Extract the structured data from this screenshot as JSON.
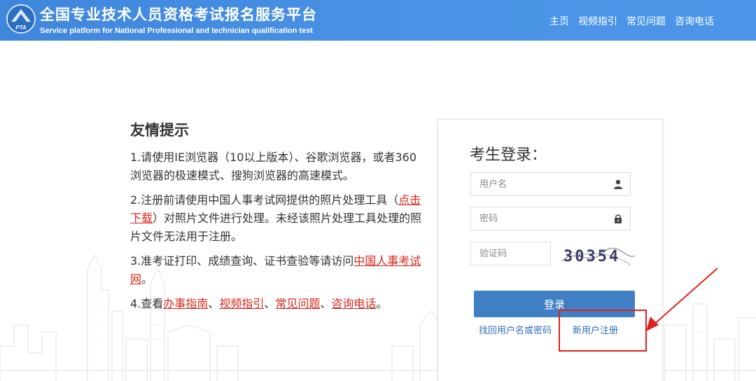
{
  "header": {
    "title": "全国专业技术人员资格考试报名服务平台",
    "subtitle": "Service platform for National Professional and technician qualification test",
    "logo_text": "PTA",
    "nav": [
      "主页",
      "视频指引",
      "常见问题",
      "咨询电话"
    ]
  },
  "tips": {
    "title": "友情提示",
    "tip1": "1.请使用IE浏览器（10以上版本）、谷歌浏览器，或者360浏览器的极速模式、搜狗浏览器的高速模式。",
    "tip2_prefix": "2.注册前请使用中国人事考试网提供的照片处理工具（",
    "tip2_link": "点击下载",
    "tip2_suffix": "）对照片文件进行处理。未经该照片处理工具处理的照片文件无法用于注册。",
    "tip3_prefix": "3.准考证打印、成绩查询、证书查验等请访问",
    "tip3_link": "中国人事考试网",
    "tip3_suffix": "。",
    "tip4_prefix": "4.查看",
    "tip4_links": [
      "办事指南",
      "视频指引",
      "常见问题",
      "咨询电话"
    ],
    "tip4_sep": "、",
    "tip4_suffix": "。"
  },
  "login": {
    "title": "考生登录：",
    "username_placeholder": "用户名",
    "password_placeholder": "密码",
    "captcha_placeholder": "验证码",
    "captcha_code": "30354",
    "login_button": "登录",
    "forgot_link": "找回用户名或密码",
    "register_link": "新用户注册"
  },
  "colors": {
    "header_bg": "#4a93e6",
    "button_bg": "#3f7fc4",
    "link_red": "#d9261c",
    "link_blue": "#2d6eb5",
    "annotation_red": "#e02020"
  },
  "icons": {
    "logo": "pta-logo-icon",
    "username": "user-icon",
    "password": "lock-icon"
  }
}
